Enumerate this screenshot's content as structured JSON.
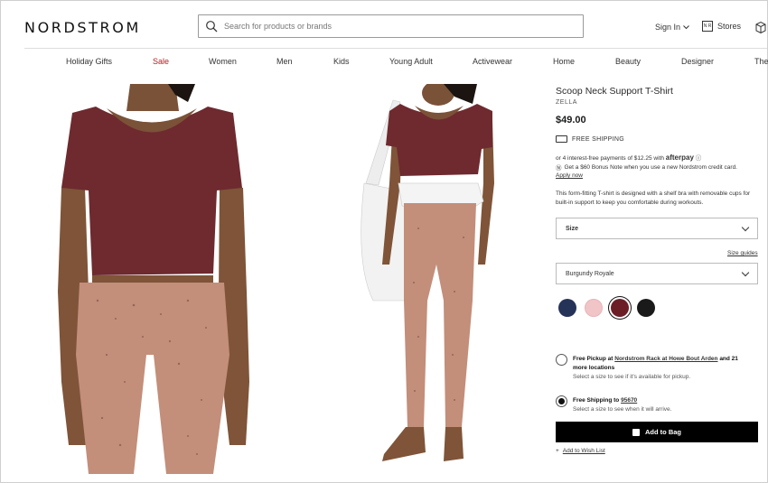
{
  "header": {
    "logo": "NORDSTROM",
    "search_placeholder": "Search for products or brands",
    "sign_in": "Sign In",
    "store_box": "N R",
    "stores": "Stores"
  },
  "nav": [
    "Holiday Gifts",
    "Sale",
    "Women",
    "Men",
    "Kids",
    "Young Adult",
    "Activewear",
    "Home",
    "Beauty",
    "Designer",
    "The"
  ],
  "product": {
    "title": "Scoop Neck Support T-Shirt",
    "brand": "ZELLA",
    "price": "$49.00",
    "shipping": "FREE SHIPPING",
    "afterpay_text": "or 4 interest-free payments of $12.25 with",
    "afterpay_brand": "afterpay",
    "bonus_text": "Get a $60 Bonus Note when you use a new Nordstrom credit card.",
    "apply": "Apply now",
    "description": "This form-fitting T-shirt is designed with a shelf bra with removable cups for built-in support to keep you comfortable during workouts.",
    "size_label": "Size",
    "size_guides": "Size guides",
    "color_selected": "Burgundy Royale",
    "swatch_colors": [
      "#263358",
      "#f1c5c7",
      "#6c1e27",
      "#1a1a1a"
    ],
    "pickup_pre": "Free Pickup at",
    "pickup_store": "Nordstrom Rack at Howe Bout Arden",
    "pickup_post": "and 21 more locations",
    "pickup_sub": "Select a size to see if it's available for pickup.",
    "ship_pre": "Free Shipping to",
    "ship_zip": "95670",
    "ship_sub": "Select a size to see when it will arrive.",
    "add_to_bag": "Add to Bag",
    "wish": "Add to Wish List"
  },
  "colors": {
    "top": "#6e2a2f",
    "leggings": "#c38e7a",
    "sale": "#b01e24"
  }
}
